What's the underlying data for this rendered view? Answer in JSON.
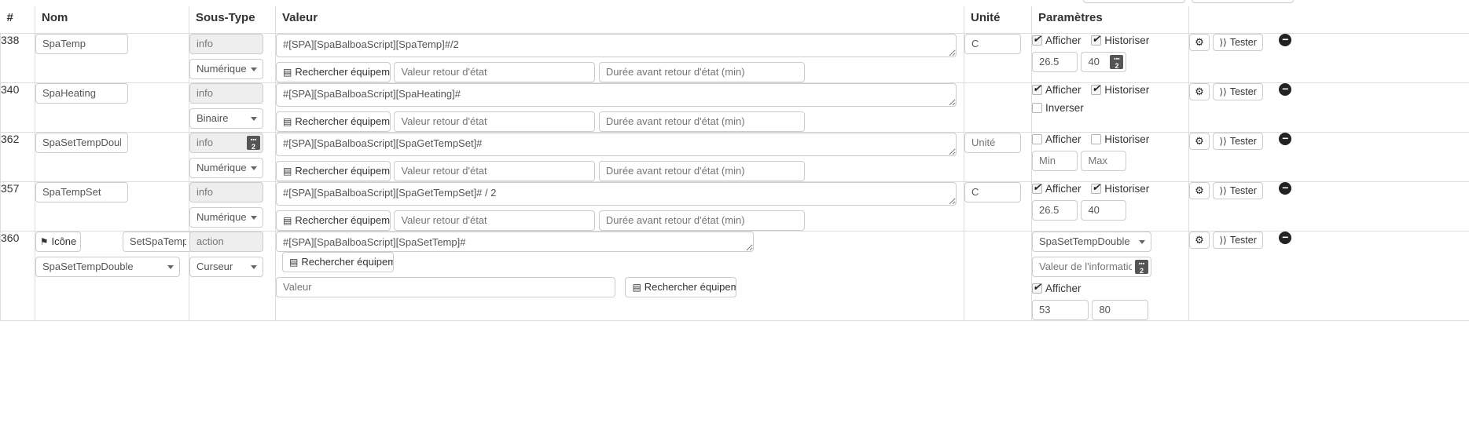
{
  "table": {
    "headers": [
      "#",
      "Nom",
      "Sous-Type",
      "Valeur",
      "Unité",
      "Paramètres",
      ""
    ],
    "common": {
      "search_equipment": "Rechercher équipement",
      "placeholder_retour": "Valeur retour d'état",
      "placeholder_duree": "Durée avant retour d'état (min)",
      "afficher": "Afficher",
      "historiser": "Historiser",
      "inverser": "Inverser",
      "tester": "Tester",
      "unite_placeholder": "Unité",
      "min_placeholder": "Min",
      "max_placeholder": "Max",
      "valeur_placeholder": "Valeur",
      "valeur_info_placeholder": "Valeur de l'information",
      "icone_label": "Icône",
      "gear_icon": "gear-icon",
      "rss_icon": "rss-icon",
      "flag_icon": "flag-icon",
      "minus_icon": "minus-circle-icon",
      "binary_icon": "binary-badge-icon",
      "list_icon": "list-icon"
    },
    "rows": [
      {
        "id": "338",
        "name": "SpaTemp",
        "type": "info",
        "subtype": "Numérique",
        "value": "#[SPA][SpaBalboaScript][SpaTemp]#/2",
        "unite": "C",
        "afficher": true,
        "historiser": true,
        "min": "26.5",
        "max": "40",
        "min_placeholder": "Min",
        "max_placeholder": "Max",
        "has_binary_icon_type": false,
        "has_binary_icon_max": true,
        "has_inverser": false
      },
      {
        "id": "340",
        "name": "SpaHeating",
        "type": "info",
        "subtype": "Binaire",
        "value": "#[SPA][SpaBalboaScript][SpaHeating]#",
        "unite": "",
        "afficher": true,
        "historiser": true,
        "inverser": false,
        "min": "",
        "max": "",
        "has_binary_icon_type": false,
        "has_binary_icon_max": false,
        "has_inverser": true
      },
      {
        "id": "362",
        "name": "SpaSetTempDouble",
        "type": "info",
        "subtype": "Numérique",
        "value": "#[SPA][SpaBalboaScript][SpaGetTempSet]#",
        "unite": "",
        "afficher": false,
        "historiser": false,
        "min": "",
        "max": "",
        "has_binary_icon_type": true,
        "has_binary_icon_max": false,
        "has_inverser": false
      },
      {
        "id": "357",
        "name": "SpaTempSet",
        "type": "info",
        "subtype": "Numérique",
        "value": "#[SPA][SpaBalboaScript][SpaGetTempSet]# / 2",
        "unite": "C",
        "afficher": true,
        "historiser": true,
        "min": "26.5",
        "max": "40",
        "has_binary_icon_type": false,
        "has_binary_icon_max": false,
        "has_inverser": false
      }
    ],
    "action_row": {
      "id": "360",
      "icone_label": "Icône",
      "command_name": "SetSpaTemp!",
      "logic_select": "SpaSetTempDouble",
      "type": "action",
      "subtype": "Curseur",
      "value": "#[SPA][SpaBalboaScript][SpaSetTemp]#",
      "value_placeholder": "Valeur",
      "search_equipment": "Rechercher équipement",
      "param_select": "SpaSetTempDouble",
      "info_value_placeholder": "Valeur de l'information",
      "afficher": "Afficher",
      "afficher_checked": true,
      "min": "53",
      "max": "80"
    }
  }
}
